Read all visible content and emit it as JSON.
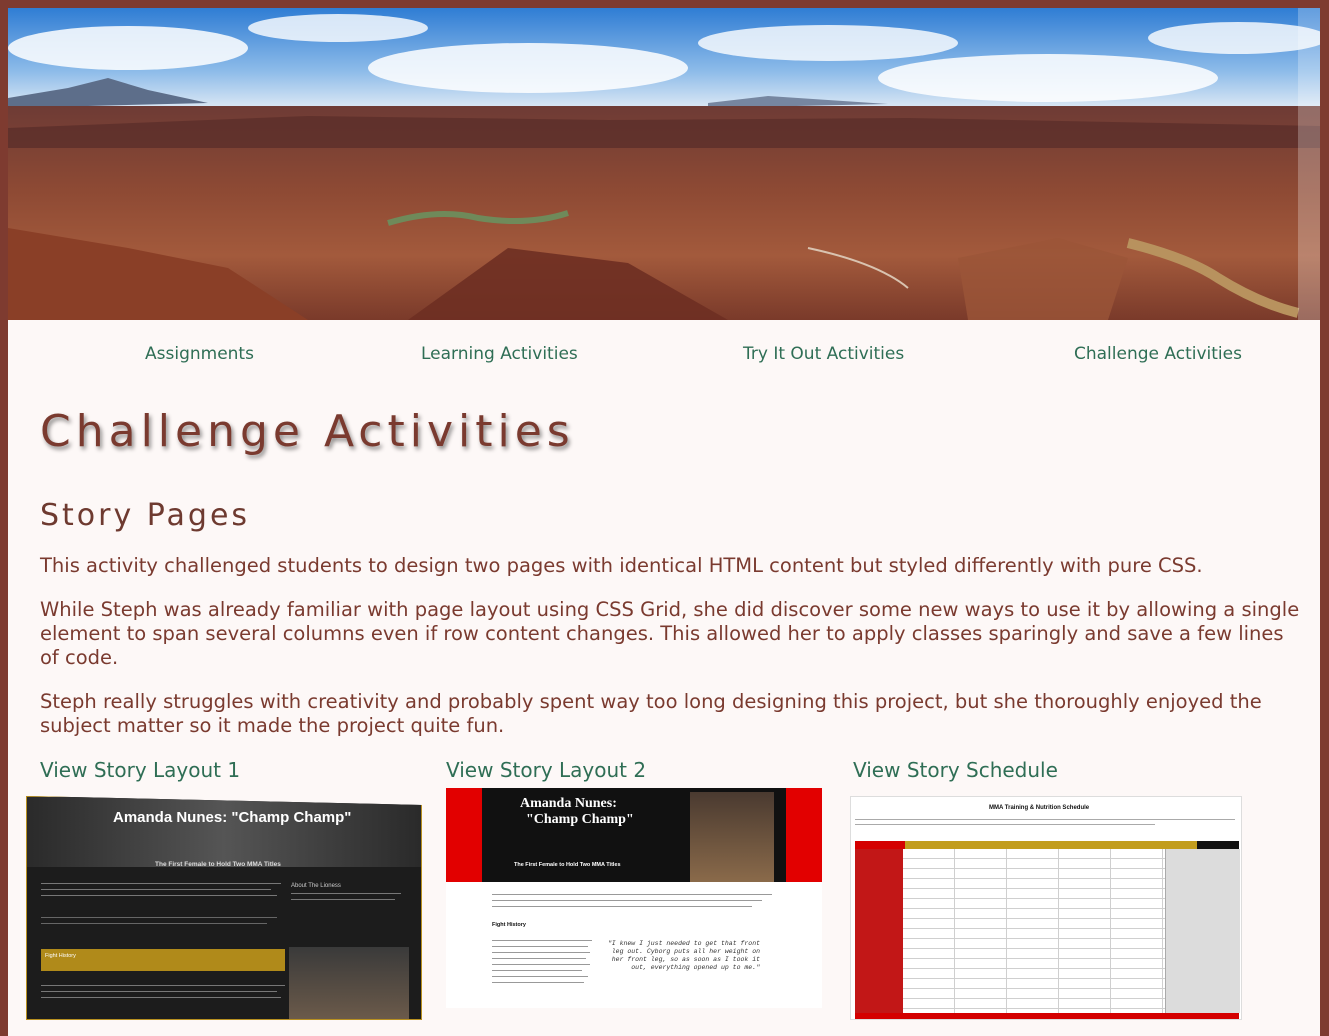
{
  "nav": {
    "items": [
      "Assignments",
      "Learning Activities",
      "Try It Out Activities",
      "Challenge Activities"
    ]
  },
  "page": {
    "title": "Challenge Activities",
    "section_title": "Story Pages",
    "paragraphs": [
      "This activity challenged students to design two pages with identical HTML content but styled differently with pure CSS.",
      "While Steph was already familiar with page layout using CSS Grid, she did discover some new ways to use it by allowing a single element to span several columns even if row content changes. This allowed her to apply classes sparingly and save a few lines of code.",
      "Steph really struggles with creativity and probably spent way too long designing this project, but she thoroughly enjoyed the subject matter so it made the project quite fun."
    ]
  },
  "cards": [
    {
      "link": "View Story Layout 1",
      "thumb_title": "Amanda Nunes: \"Champ Champ\"",
      "thumb_subtitle": "The First Female to Hold Two MMA Titles",
      "thumb_side": "About The Lioness",
      "thumb_section": "Fight History"
    },
    {
      "link": "View Story Layout 2",
      "thumb_title_line1": "Amanda Nunes:",
      "thumb_title_line2": "\"Champ Champ\"",
      "thumb_subtitle": "The First Female to Hold Two MMA Titles",
      "thumb_section": "Fight History",
      "thumb_quote": "\"I knew I just needed to get that front leg out. Cyborg puts all her weight on her front leg, so as soon as I took it out, everything opened up to me.\""
    },
    {
      "link": "View Story Schedule",
      "thumb_title": "MMA Training & Nutrition Schedule"
    }
  ],
  "colors": {
    "frame": "#7e3b30",
    "link": "#2f6e55",
    "heading": "#7a3a2f"
  }
}
